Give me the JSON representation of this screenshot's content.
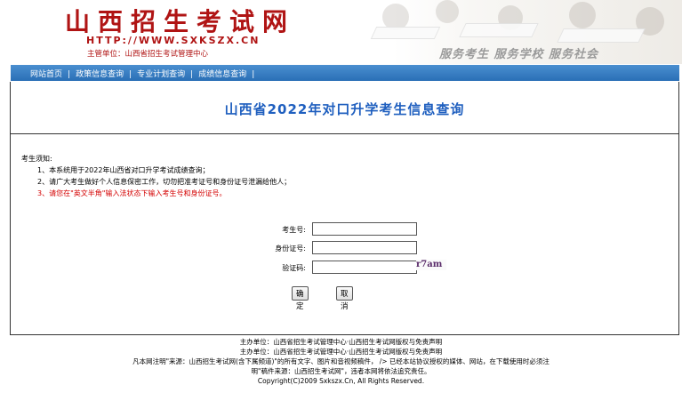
{
  "header": {
    "site_title": "山西招生考试网",
    "url": "HTTP://WWW.SXKSZX.CN",
    "sponsor": "主管单位：山西省招生考试管理中心",
    "slogan": "服务考生  服务学校  服务社会"
  },
  "nav": {
    "items": [
      {
        "label": "网站首页"
      },
      {
        "label": "政策信息查询"
      },
      {
        "label": "专业计划查询"
      },
      {
        "label": "成绩信息查询"
      }
    ],
    "separator": "|"
  },
  "page": {
    "title": "山西省2022年对口升学考生信息查询"
  },
  "notice": {
    "heading": "考生须知:",
    "items": [
      "1、本系统用于2022年山西省对口升学考试成绩查询；",
      "2、请广大考生做好个人信息保密工作，切勿把准考证号和身份证号泄漏给他人；",
      "3、请您在\"英文半角\"输入法状态下输入考生号和身份证号。"
    ],
    "warning_color": "#d40000"
  },
  "form": {
    "candidate_label": "考生号:",
    "candidate_value": "",
    "id_label": "身份证号:",
    "id_value": "",
    "captcha_label": "验证码:",
    "captcha_value": "",
    "captcha_image_text": "r7am",
    "submit_label": "确定",
    "cancel_label": "取消"
  },
  "footer": {
    "line1": "主办单位：山西省招生考试管理中心·山西招生考试网版权与免责声明",
    "line2": "主办单位：山西省招生考试管理中心·山西招生考试网版权与免责声明",
    "line3": "凡本网注明\"来源：山西招生考试网(含下属频道)\"的所有文字、图片和音视频稿件， /> 已经本站协议授权的媒体、网站，在下载使用时必须注",
    "line4": "明\"稿件来源：山西招生考试网\"，违者本网将依法追究责任。",
    "copyright": "Copyright(C)2009 Sxkszx.Cn, All Rights Reserved."
  },
  "colors": {
    "brand_red": "#b01414",
    "title_blue": "#1f5fbf",
    "nav_blue": "#2a6fb6"
  }
}
